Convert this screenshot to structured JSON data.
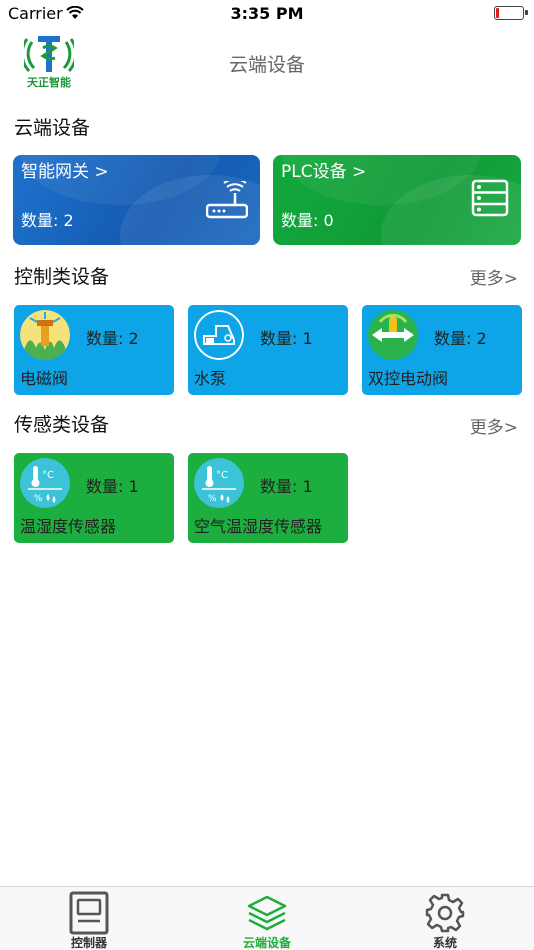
{
  "status_bar": {
    "carrier": "Carrier",
    "time": "3:35 PM",
    "battery_level": 0.1
  },
  "nav": {
    "logo_text": "天正智能",
    "title": "云端设备"
  },
  "cloud_section": {
    "title": "云端设备",
    "cards": [
      {
        "label": "智能网关 >",
        "count": "数量: 2",
        "icon": "router-icon",
        "color": "#1459b0"
      },
      {
        "label": "PLC设备 >",
        "count": "数量: 0",
        "icon": "server-icon",
        "color": "#0f9a36"
      }
    ]
  },
  "control_section": {
    "title": "控制类设备",
    "more": "更多>",
    "cards": [
      {
        "name": "电磁阀",
        "count": "数量: 2",
        "icon": "sprinkler-icon"
      },
      {
        "name": "水泵",
        "count": "数量: 1",
        "icon": "water-pump-icon"
      },
      {
        "name": "双控电动阀",
        "count": "数量: 2",
        "icon": "motor-valve-icon"
      }
    ]
  },
  "sensor_section": {
    "title": "传感类设备",
    "more": "更多>",
    "cards": [
      {
        "name": "温湿度传感器",
        "count": "数量: 1",
        "icon": "temp-humidity-icon"
      },
      {
        "name": "空气温湿度传感器",
        "count": "数量: 1",
        "icon": "air-temp-humidity-icon"
      }
    ]
  },
  "tabs": [
    {
      "label": "控制器",
      "icon": "controller-icon",
      "active": false
    },
    {
      "label": "云端设备",
      "icon": "layers-icon",
      "active": true
    },
    {
      "label": "系统",
      "icon": "gear-icon",
      "active": false
    }
  ],
  "colors": {
    "blue_card": "#0da5e8",
    "green_card": "#1cae3e",
    "active_tab": "#1cae3e"
  }
}
